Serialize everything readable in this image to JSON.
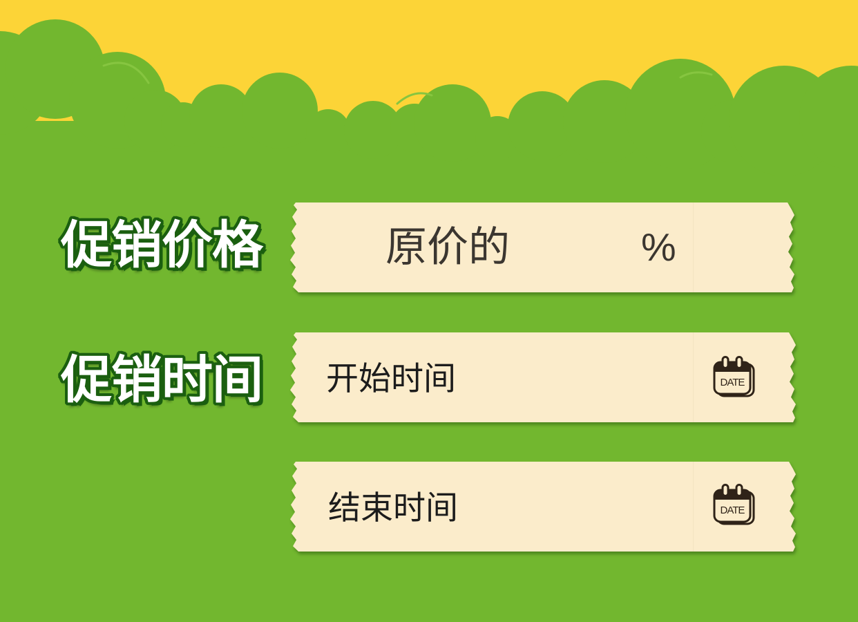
{
  "colors": {
    "sky": "#fcd437",
    "grass": "#72b72f",
    "panel": "#fbeccb",
    "label_fill": "#ffffff",
    "label_outline": "#1b5f10",
    "icon": "#2f2318"
  },
  "promotion_price": {
    "label": "促销价格",
    "prefix": "原价的",
    "suffix": "%"
  },
  "promotion_time": {
    "label": "促销时间",
    "start_placeholder": "开始时间",
    "end_placeholder": "结束时间",
    "calendar_icon": "calendar-icon",
    "calendar_icon_text": "DATE"
  }
}
